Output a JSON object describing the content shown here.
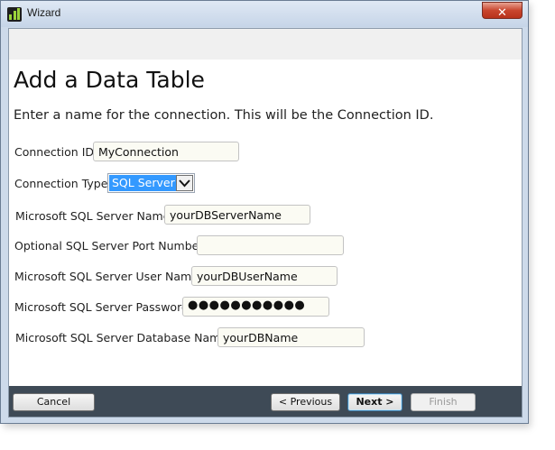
{
  "window": {
    "title": "Wizard",
    "close_label": "✕"
  },
  "page": {
    "heading": "Add a Data Table",
    "instruction": "Enter a name for the connection. This will be the Connection ID."
  },
  "form": {
    "connection_id": {
      "label": "Connection ID",
      "value": "MyConnection"
    },
    "connection_type": {
      "label": "Connection Type",
      "value": "SQL Server"
    },
    "server_name": {
      "label": "Microsoft SQL Server Name",
      "value": "yourDBServerName"
    },
    "port": {
      "label": "Optional SQL Server Port Number",
      "value": ""
    },
    "user_name": {
      "label": "Microsoft SQL Server User Name",
      "value": "yourDBUserName"
    },
    "password": {
      "label": "Microsoft SQL Server Password",
      "value": "●●●●●●●●●●●"
    },
    "database_name": {
      "label": "Microsoft SQL Server Database Name",
      "value": "yourDBName"
    }
  },
  "footer": {
    "cancel": "Cancel",
    "previous": "< Previous",
    "next": "Next >",
    "finish": "Finish"
  },
  "colors": {
    "accent": "#3399ff",
    "footer_bg": "#3e4a56",
    "close_red": "#c9462f"
  }
}
